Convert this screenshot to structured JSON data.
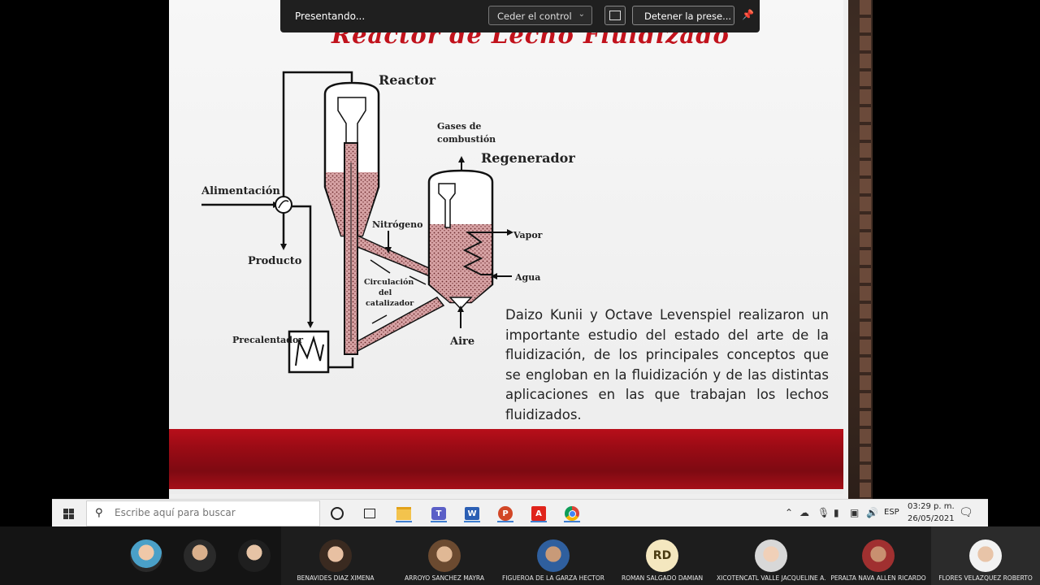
{
  "presenter_bar": {
    "presenting_label": "Presentando...",
    "give_control_label": "Ceder el control",
    "stop_presenting_label": "Detener la prese..."
  },
  "slide": {
    "title": "Reactor de Lecho Fluidizado",
    "body": "Daizo Kunii y Octave Levenspiel realizaron un importante estudio del estado del arte de la fluidización, de los principales conceptos que se engloban en la fluidización y de las distintas aplicaciones en las que trabajan los lechos fluidizados.",
    "diagram_labels": {
      "reactor": "Reactor",
      "gases_1": "Gases de",
      "gases_2": "combustión",
      "regenerador": "Regenerador",
      "alimentacion": "Alimentación",
      "nitrogeno": "Nitrógeno",
      "vapor": "Vapor",
      "producto": "Producto",
      "agua": "Agua",
      "circ_1": "Circulación",
      "circ_2": "del",
      "circ_3": "catalizador",
      "aire": "Aire",
      "precalentador": "Precalentador"
    },
    "colors": {
      "accent": "#c1121c",
      "band": "#9b0b15",
      "bed": "#c98a8c"
    }
  },
  "taskbar": {
    "search_placeholder": "Escribe aquí para buscar",
    "icons": [
      "windows-start-icon",
      "search-icon",
      "cortana-icon",
      "task-view-icon",
      "file-explorer-icon",
      "teams-icon",
      "word-icon",
      "powerpoint-icon",
      "acrobat-icon",
      "chrome-icon"
    ],
    "language": "ESP",
    "time": "03:29 p. m.",
    "date": "26/05/2021"
  },
  "participants": [
    {
      "name": ""
    },
    {
      "name": ""
    },
    {
      "name": ""
    },
    {
      "name": "BENAVIDES DIAZ XIMENA"
    },
    {
      "name": "ARROYO SANCHEZ MAYRA"
    },
    {
      "name": "FIGUEROA DE LA GARZA HECTOR"
    },
    {
      "name": "ROMAN SALGADO DAMIAN",
      "initials": "RD"
    },
    {
      "name": "XICOTENCATL VALLE JACQUELINE A..."
    },
    {
      "name": "PERALTA NAVA ALLEN RICARDO"
    },
    {
      "name": "FLORES VELAZQUEZ ROBERTO"
    }
  ]
}
